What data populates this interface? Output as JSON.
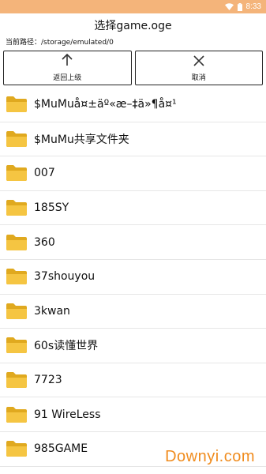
{
  "status_bar": {
    "time": "8:33"
  },
  "dialog": {
    "title": "选择game.oge",
    "current_path": "当前路径：/storage/emulated/0"
  },
  "buttons": {
    "back_label": "返回上级",
    "cancel_label": "取消"
  },
  "files": [
    {
      "name": "$MuMuå¤±äº«æ–‡ä»¶å¤¹",
      "icon": "folder-icon"
    },
    {
      "name": "$MuMu共享文件夹",
      "icon": "folder-icon"
    },
    {
      "name": "007",
      "icon": "folder-icon"
    },
    {
      "name": "185SY",
      "icon": "folder-icon"
    },
    {
      "name": "360",
      "icon": "folder-icon"
    },
    {
      "name": "37shouyou",
      "icon": "folder-icon"
    },
    {
      "name": "3kwan",
      "icon": "folder-icon"
    },
    {
      "name": "60s读懂世界",
      "icon": "folder-icon"
    },
    {
      "name": "7723",
      "icon": "folder-icon"
    },
    {
      "name": "91 WireLess",
      "icon": "folder-icon"
    },
    {
      "name": "985GAME",
      "icon": "folder-icon"
    }
  ],
  "watermark": "Downyi.com",
  "colors": {
    "status_bar": "#f4b47a",
    "folder": "#f5c542",
    "watermark": "#f08c1e"
  }
}
